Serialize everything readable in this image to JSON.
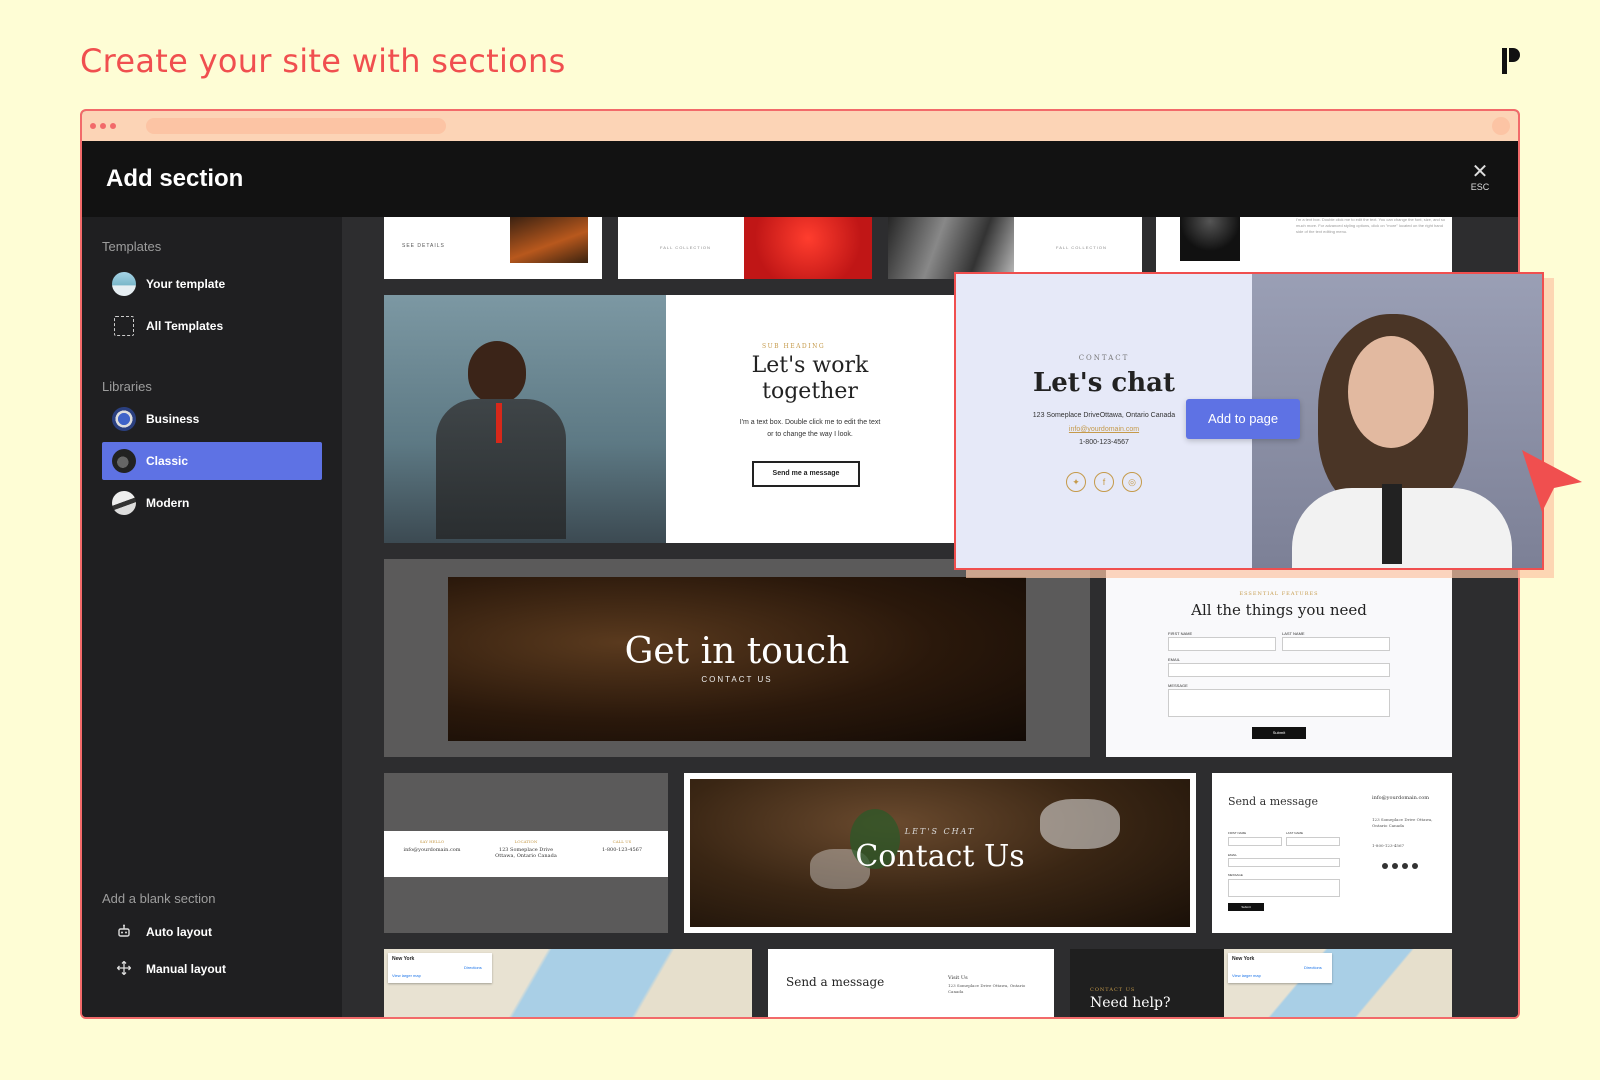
{
  "page": {
    "headline": "Create your site with sections"
  },
  "modal": {
    "title": "Add section",
    "close_label": "ESC"
  },
  "sidebar": {
    "templates_heading": "Templates",
    "templates": [
      {
        "label": "Your template",
        "icon": "template-thumb-icon"
      },
      {
        "label": "All Templates",
        "icon": "grid-icon"
      }
    ],
    "libraries_heading": "Libraries",
    "libraries": [
      {
        "label": "Business",
        "icon": "business-thumb-icon"
      },
      {
        "label": "Classic",
        "icon": "classic-thumb-icon",
        "active": true
      },
      {
        "label": "Modern",
        "icon": "modern-thumb-icon"
      }
    ],
    "blank_heading": "Add a blank section",
    "blank": [
      {
        "label": "Auto layout",
        "icon": "robot-icon"
      },
      {
        "label": "Manual layout",
        "icon": "move-icon"
      }
    ]
  },
  "cards": {
    "top_row": {
      "c1_link": "SEE DETAILS",
      "c2_label": "FALL COLLECTION",
      "c3_label": "FALL COLLECTION",
      "c4_text": "I'm a text box. Double click me to edit the text. You can change the font, size, and so much more. For advanced styling options, click on \"more\" located on the right hand side of the text editing menu."
    },
    "work": {
      "sub": "SUB HEADING",
      "title_line1": "Let's work",
      "title_line2": "together",
      "body_line1": "I'm a text box. Double click me to edit the text",
      "body_line2": "or to change the way I look.",
      "button": "Send me a message"
    },
    "chat": {
      "sub": "CONTACT",
      "title": "Let's chat",
      "address": "123 Someplace DriveOttawa, Ontario Canada",
      "email": "info@yourdomain.com",
      "phone": "1-800-123-4567",
      "add_button": "Add to page"
    },
    "touch": {
      "title": "Get in touch",
      "sub": "CONTACT US"
    },
    "form": {
      "sub": "ESSENTIAL FEATURES",
      "title": "All the things you need",
      "first": "FIRST NAME",
      "last": "LAST NAME",
      "email": "EMAIL",
      "message": "MESSAGE",
      "submit": "Submit"
    },
    "strip": {
      "col1_head": "SAY HELLO",
      "col1_val": "info@yourdomain.com",
      "col2_head": "LOCATION",
      "col2_val": "123 Someplace Drive Ottawa, Ontario Canada",
      "col3_head": "CALL US",
      "col3_val": "1-800-123-4567"
    },
    "contact_us": {
      "sub": "LET'S CHAT",
      "title": "Contact Us"
    },
    "send": {
      "title": "Send a message",
      "email": "info@yourdomain.com",
      "address": "123 Someplace Drive Ottawa, Ontario Canada",
      "phone": "1-800-123-4567",
      "first": "FIRST NAME",
      "last": "LAST NAME",
      "email_label": "EMAIL",
      "message_label": "MESSAGE",
      "submit": "Submit"
    },
    "bottom": {
      "map1_city": "New York",
      "map1_link": "View larger map",
      "map1_dir": "Directions",
      "send2_title": "Send a message",
      "send2_visit": "Visit Us",
      "send2_address": "123 Someplace Drive Ottawa, Ontario Canada",
      "help_sub": "CONTACT US",
      "help_title": "Need help?",
      "map2_city": "New York",
      "map2_link": "View larger map",
      "map2_dir": "Directions"
    }
  },
  "colors": {
    "accent": "#5e72e4",
    "brand_red": "#f04f4f",
    "page_bg": "#fefdd5"
  }
}
